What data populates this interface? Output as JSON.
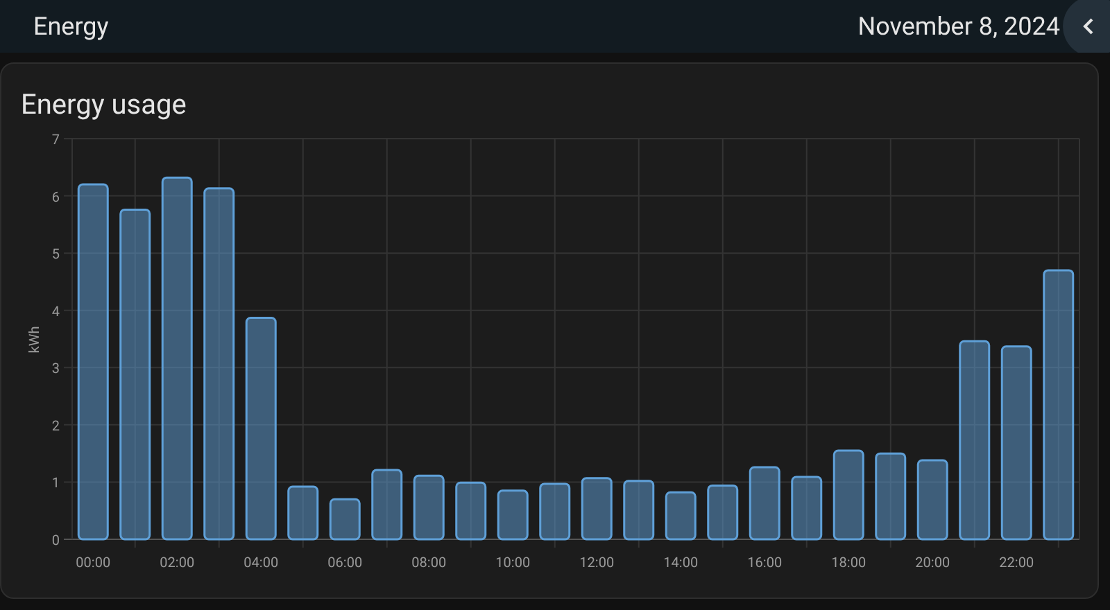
{
  "header": {
    "title": "Energy",
    "date": "November 8, 2024"
  },
  "card": {
    "title": "Energy usage",
    "chart_data": {
      "type": "bar",
      "ylabel": "kWh",
      "ylim": [
        0,
        7
      ],
      "yticks": [
        0,
        1,
        2,
        3,
        4,
        5,
        6,
        7
      ],
      "grid": true,
      "categories": [
        "00:00",
        null,
        "02:00",
        null,
        "04:00",
        null,
        "06:00",
        null,
        "08:00",
        null,
        "10:00",
        null,
        "12:00",
        null,
        "14:00",
        null,
        "16:00",
        null,
        "18:00",
        null,
        "20:00",
        null,
        "22:00",
        null
      ],
      "series": [
        {
          "color": "#5fa0d8",
          "values": [
            6.2,
            5.76,
            6.32,
            6.13,
            3.87,
            0.92,
            0.7,
            1.21,
            1.11,
            0.99,
            0.85,
            0.97,
            1.07,
            1.02,
            0.82,
            0.94,
            1.26,
            1.09,
            1.55,
            1.5,
            1.38,
            3.46,
            3.37,
            4.7
          ]
        }
      ]
    }
  }
}
